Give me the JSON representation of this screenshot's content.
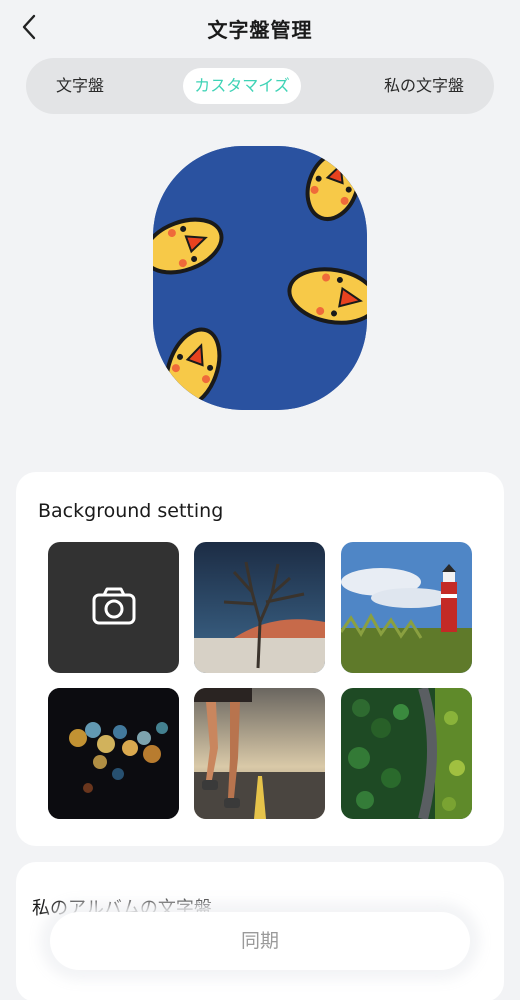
{
  "header": {
    "title": "文字盤管理",
    "back_icon": "chevron-left-icon"
  },
  "tabs": [
    {
      "label": "文字盤",
      "active": false
    },
    {
      "label": "カスタマイズ",
      "active": true
    },
    {
      "label": "私の文字盤",
      "active": false
    }
  ],
  "colors": {
    "accent": "#3fd3b6",
    "watch_background": "#2a52a0",
    "page_background": "#f2f3f5"
  },
  "background_setting": {
    "title": "Background setting",
    "camera_icon": "camera-icon",
    "images": [
      "dead-tree-desert",
      "red-lighthouse",
      "bokeh-lights",
      "runner-road",
      "forest-road-aerial"
    ]
  },
  "album": {
    "title": "私のアルバムの文字盤"
  },
  "sync_button": {
    "label": "同期"
  }
}
